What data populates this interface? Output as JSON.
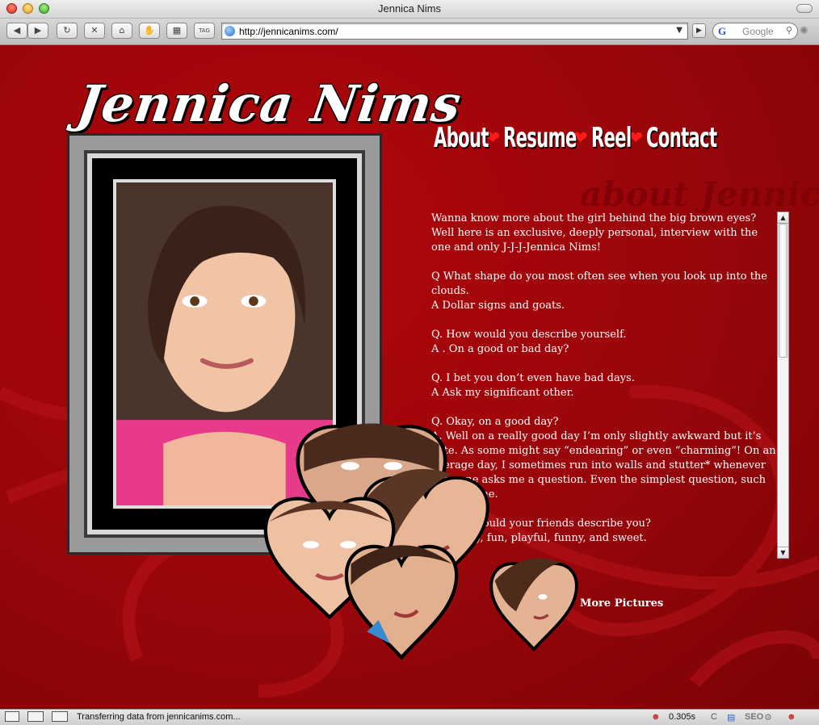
{
  "window": {
    "title": "Jennica Nims"
  },
  "toolbar": {
    "url": "http://jennicanims.com/",
    "search_placeholder": "Google",
    "search_engine_glyph": "G",
    "buttons": [
      "back",
      "forward",
      "reload",
      "stop",
      "home",
      "bookmark",
      "snapback",
      "tag"
    ]
  },
  "site": {
    "logo": "Jennica Nims",
    "nav": [
      {
        "label": "About"
      },
      {
        "label": "Resume"
      },
      {
        "label": "Reel"
      },
      {
        "label": "Contact"
      }
    ],
    "section_title": "about Jennica",
    "interview": [
      "Wanna know more about the girl behind the big brown eyes?  Well here is an exclusive, deeply personal, interview with the one and only J-J-J-Jennica Nims!",
      "Q  What shape do you most often see when you look up into the clouds.",
      "A   Dollar signs and goats.",
      "Q.  How would you describe yourself.",
      "A .  On a good or bad day?",
      "Q.   I bet you don’t even have bad days.",
      "A    Ask my significant other.",
      "Q.   Okay, on a good day?",
      "A.    Well on a really good day I’m only slightly awkward but it’s cute. As some might say “endearing” or even “charming”!  On an average day, I sometimes run into walls and stutter* whenever someone asks me a question.  Even the simplest question, such as my name.",
      "Q.   How would your friends describe you?",
      "A.   Quirky, fun, playful, funny, and sweet."
    ],
    "more_pictures_label": "More Pictures",
    "colors": {
      "background": "#9a060a",
      "heart": "#ff1a1a",
      "text": "#ffffff"
    }
  },
  "statusbar": {
    "message": "Transferring data from jennicanims.com...",
    "timing": "0.305s"
  }
}
